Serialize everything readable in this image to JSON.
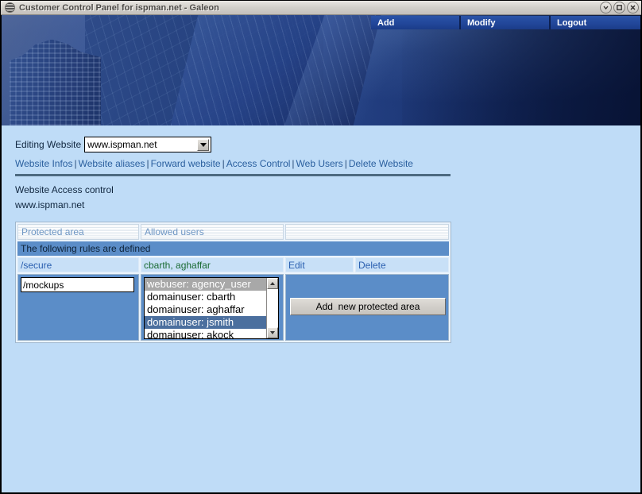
{
  "window": {
    "title": "Customer Control Panel for ispman.net - Galeon",
    "icon": "app-icon",
    "controls": [
      {
        "name": "minimize",
        "glyph": "▽"
      },
      {
        "name": "maximize",
        "glyph": "▢"
      },
      {
        "name": "close",
        "glyph": "✕"
      }
    ]
  },
  "topnav": {
    "items": [
      {
        "label": "Add"
      },
      {
        "label": "Modify"
      },
      {
        "label": "Logout"
      }
    ]
  },
  "form": {
    "editing_label": "Editing Website",
    "website_value": "www.ispman.net",
    "website_options": [
      "www.ispman.net"
    ]
  },
  "navlinks": {
    "separator": "|",
    "items": [
      {
        "label": "Website Infos"
      },
      {
        "label": "Website aliases"
      },
      {
        "label": "Forward website"
      },
      {
        "label": "Access Control"
      },
      {
        "label": "Web Users"
      },
      {
        "label": "Delete Website"
      }
    ]
  },
  "page": {
    "heading": "Website Access control",
    "subheading": "www.ispman.net"
  },
  "table": {
    "headers": [
      {
        "label": "Protected area"
      },
      {
        "label": "Allowed users"
      },
      {
        "label": ""
      }
    ],
    "status_bar": "The following rules are defined",
    "rule_row": {
      "area": "/secure",
      "users": "cbarth, aghaffar",
      "edit_label": "Edit",
      "delete_label": "Delete"
    },
    "new_row": {
      "area_value": "/mockups",
      "area_placeholder": "",
      "users_list": [
        {
          "label": "webuser: agency_user",
          "state": "sel-inactive"
        },
        {
          "label": "domainuser: cbarth",
          "state": ""
        },
        {
          "label": "domainuser: aghaffar",
          "state": ""
        },
        {
          "label": "domainuser: jsmith",
          "state": "sel-active"
        },
        {
          "label": "domainuser: akock",
          "state": ""
        }
      ],
      "add_button_label": "Add  new protected area"
    }
  },
  "colors": {
    "page_background": "#bfdcf7",
    "banner_blue": "#1d3a80",
    "panel_blue": "#5b8dc8",
    "cell_blue": "#c8e0f7",
    "link_blue": "#2a5fb0",
    "users_green": "#1a6b33",
    "selection_active": "#4b6f9e",
    "selection_inactive": "#a8a8a8"
  }
}
